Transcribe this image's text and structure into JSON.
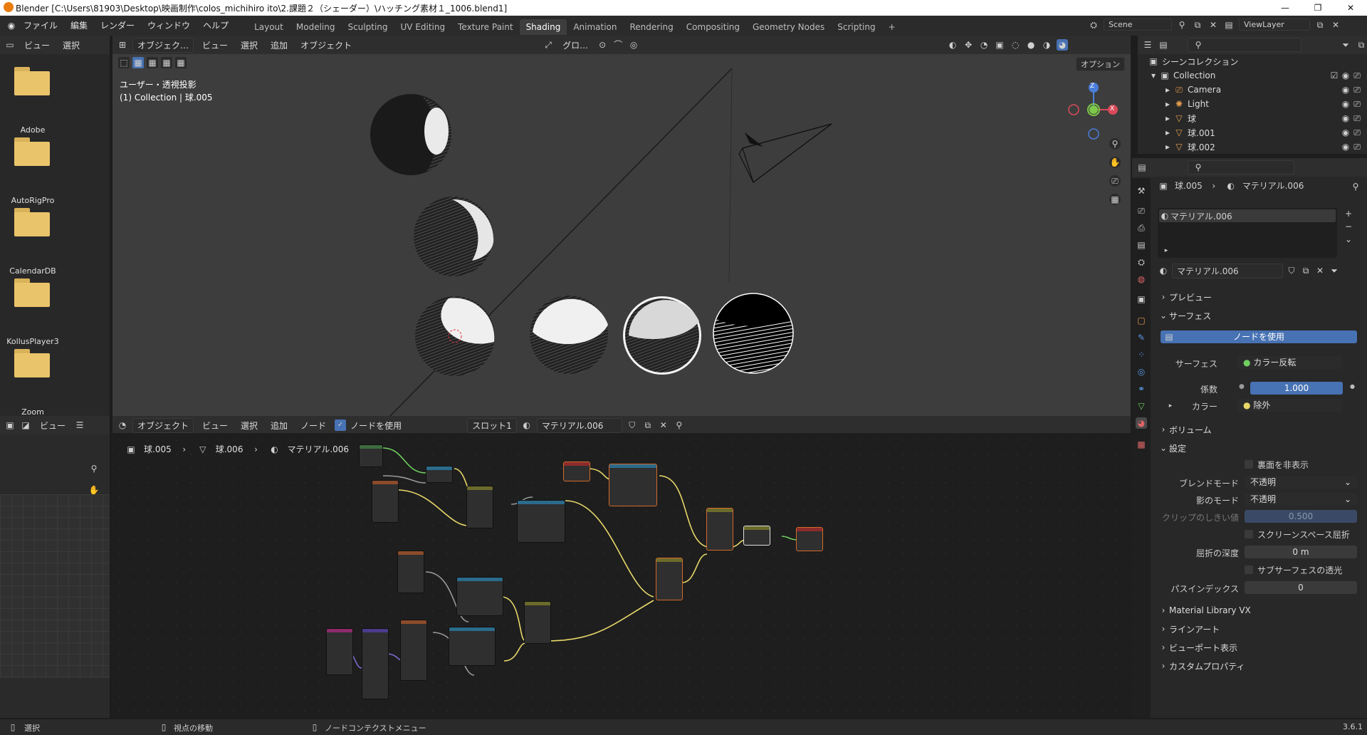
{
  "title_bar": {
    "text": "Blender [C:\\Users\\81903\\Desktop\\映画制作\\colos_michihiro ito\\2.課題２（シェーダー）\\ハッチング素材１_1006.blend1]",
    "minimize": "—",
    "maximize": "❐",
    "close": "✕"
  },
  "menu": [
    "ファイル",
    "編集",
    "レンダー",
    "ウィンドウ",
    "ヘルプ"
  ],
  "workspaces": [
    "Layout",
    "Modeling",
    "Sculpting",
    "UV Editing",
    "Texture Paint",
    "Shading",
    "Animation",
    "Rendering",
    "Compositing",
    "Geometry Nodes",
    "Scripting"
  ],
  "workspace_add": "+",
  "scene": {
    "scene_name": "Scene",
    "view_layer": "ViewLayer"
  },
  "file_browser": {
    "header": [
      "ビュー",
      "選択"
    ],
    "folders": [
      "Adobe",
      "AutoRigPro",
      "CalendarDB",
      "KollusPlayer3",
      "Zoom"
    ]
  },
  "viewport": {
    "header": {
      "mode": "オブジェク…",
      "menus": [
        "ビュー",
        "選択",
        "追加",
        "オブジェクト"
      ],
      "transform": "グロ…",
      "options": "オプション"
    },
    "overlay_line1": "ユーザー・透視投影",
    "overlay_line2": "(1) Collection | 球.005",
    "gizmo": {
      "z": "Z",
      "y": "Y",
      "x": "X"
    }
  },
  "image_editor": {
    "header_view": "ビュー"
  },
  "node_editor": {
    "header": {
      "mode": "オブジェクト",
      "menus": [
        "ビュー",
        "選択",
        "追加",
        "ノード"
      ],
      "use_nodes_label": "ノードを使用",
      "slot": "スロット1",
      "material": "マテリアル.006"
    },
    "breadcrumb": [
      "球.005",
      "球.006",
      "マテリアル.006"
    ]
  },
  "outliner": {
    "root": "シーンコレクション",
    "collection": "Collection",
    "items": [
      "Camera",
      "Light",
      "球",
      "球.001",
      "球.002"
    ]
  },
  "properties": {
    "breadcrumb_object": "球.005",
    "breadcrumb_material": "マテリアル.006",
    "material_slot": "マテリアル.006",
    "material_name": "マテリアル.006",
    "sections": {
      "preview": "プレビュー",
      "surface": "サーフェス",
      "volume": "ボリューム",
      "settings": "設定",
      "material_library": "Material Library VX",
      "lineart": "ラインアート",
      "viewport_display": "ビューポート表示",
      "custom_props": "カスタムプロパティ"
    },
    "use_nodes_button": "ノードを使用",
    "surface_label": "サーフェス",
    "surface_value": "カラー反転",
    "factor_label": "係数",
    "factor_value": "1.000",
    "color_label": "カラー",
    "color_value": "除外",
    "backface_culling": "裏面を非表示",
    "blend_mode_label": "ブレンドモード",
    "blend_mode_value": "不透明",
    "shadow_mode_label": "影のモード",
    "shadow_mode_value": "不透明",
    "clip_threshold_label": "クリップのしきい値",
    "clip_threshold_value": "0.500",
    "ssr_label": "スクリーンスペース屈折",
    "refraction_depth_label": "屈折の深度",
    "refraction_depth_value": "0 m",
    "sss_label": "サブサーフェスの透光",
    "pass_index_label": "パスインデックス",
    "pass_index_value": "0"
  },
  "status_bar": {
    "select": "選択",
    "move_view": "視点の移動",
    "node_context": "ノードコンテクストメニュー",
    "version": "3.6.1"
  },
  "colors": {
    "accent_blue": "#4772b3",
    "folder": "#e9c46a",
    "active_tab": "#3d3d3d"
  }
}
